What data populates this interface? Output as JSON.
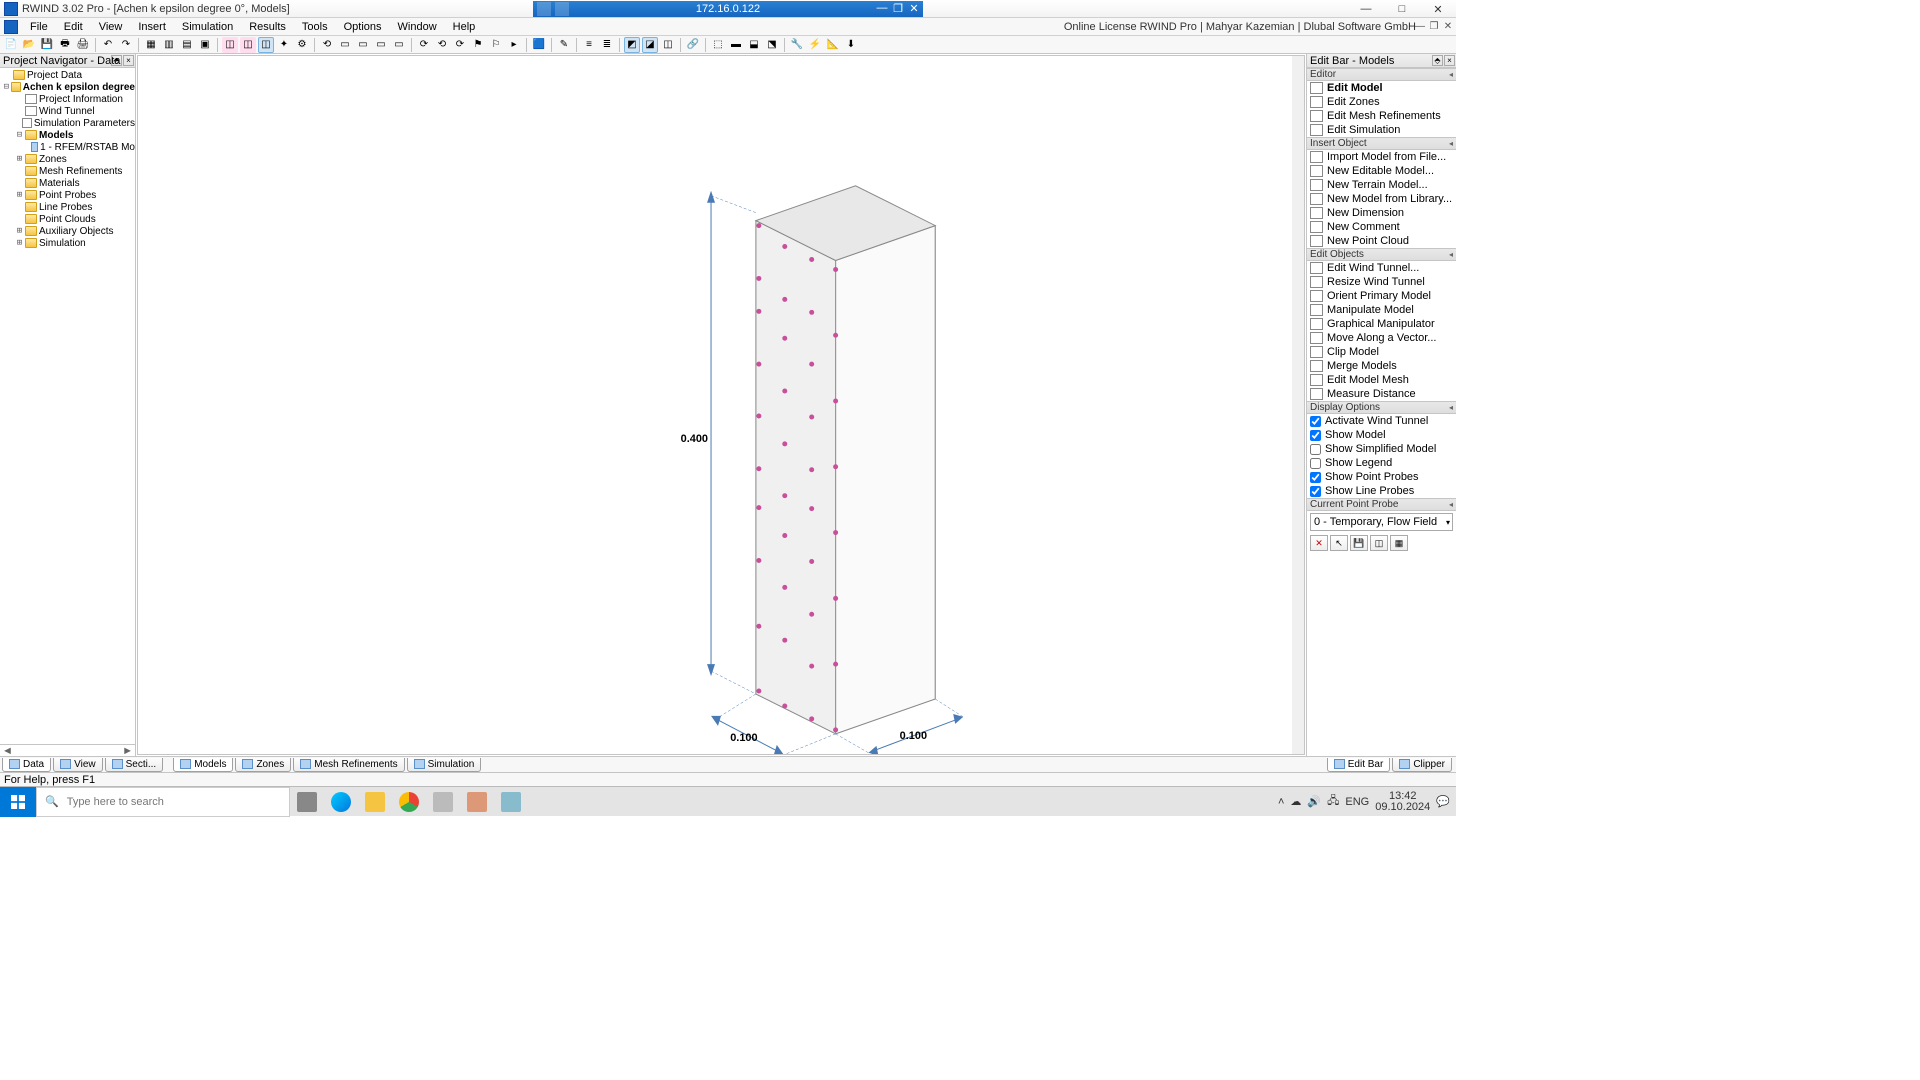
{
  "titlebar": {
    "title": "RWIND 3.02 Pro - [Achen  k epsilon degree 0°, Models]",
    "ip": "172.16.0.122"
  },
  "menubar": {
    "items": [
      "File",
      "Edit",
      "View",
      "Insert",
      "Simulation",
      "Results",
      "Tools",
      "Options",
      "Window",
      "Help"
    ],
    "license": "Online License RWIND Pro | Mahyar Kazemian | Dlubal Software GmbH"
  },
  "left": {
    "title": "Project Navigator - Data",
    "tree": [
      {
        "d": 0,
        "t": "",
        "i": "folder",
        "l": "Project Data",
        "b": false
      },
      {
        "d": 0,
        "t": "⊟",
        "i": "folder-open",
        "l": "Achen  k epsilon degree",
        "b": true
      },
      {
        "d": 1,
        "t": "",
        "i": "page",
        "l": "Project Information",
        "b": false
      },
      {
        "d": 1,
        "t": "",
        "i": "page",
        "l": "Wind Tunnel",
        "b": false
      },
      {
        "d": 1,
        "t": "",
        "i": "page",
        "l": "Simulation Parameters",
        "b": false
      },
      {
        "d": 1,
        "t": "⊟",
        "i": "folder-open",
        "l": "Models",
        "b": true
      },
      {
        "d": 2,
        "t": "",
        "i": "model",
        "l": "1 - RFEM/RSTAB Mo",
        "b": false
      },
      {
        "d": 1,
        "t": "⊞",
        "i": "folder",
        "l": "Zones",
        "b": false
      },
      {
        "d": 1,
        "t": "",
        "i": "folder",
        "l": "Mesh Refinements",
        "b": false
      },
      {
        "d": 1,
        "t": "",
        "i": "folder",
        "l": "Materials",
        "b": false
      },
      {
        "d": 1,
        "t": "⊞",
        "i": "folder",
        "l": "Point Probes",
        "b": false
      },
      {
        "d": 1,
        "t": "",
        "i": "folder",
        "l": "Line Probes",
        "b": false
      },
      {
        "d": 1,
        "t": "",
        "i": "folder",
        "l": "Point Clouds",
        "b": false
      },
      {
        "d": 1,
        "t": "⊞",
        "i": "folder",
        "l": "Auxiliary Objects",
        "b": false
      },
      {
        "d": 1,
        "t": "⊞",
        "i": "folder",
        "l": "Simulation",
        "b": false
      }
    ]
  },
  "viewport": {
    "dim_h": "0.400",
    "dim_w1": "0.100",
    "dim_w2": "0.100"
  },
  "right": {
    "title": "Edit Bar - Models",
    "sections": {
      "editor": {
        "hdr": "Editor",
        "items": [
          {
            "l": "Edit Model",
            "b": true
          },
          {
            "l": "Edit Zones",
            "b": false
          },
          {
            "l": "Edit Mesh Refinements",
            "b": false
          },
          {
            "l": "Edit Simulation",
            "b": false
          }
        ]
      },
      "insert": {
        "hdr": "Insert Object",
        "items": [
          {
            "l": "Import Model from File..."
          },
          {
            "l": "New Editable Model..."
          },
          {
            "l": "New Terrain Model..."
          },
          {
            "l": "New Model from Library..."
          },
          {
            "l": "New Dimension"
          },
          {
            "l": "New Comment"
          },
          {
            "l": "New Point Cloud"
          }
        ]
      },
      "editobj": {
        "hdr": "Edit Objects",
        "items": [
          {
            "l": "Edit Wind Tunnel..."
          },
          {
            "l": "Resize Wind Tunnel"
          },
          {
            "l": "Orient Primary Model"
          },
          {
            "l": "Manipulate Model"
          },
          {
            "l": "Graphical Manipulator"
          },
          {
            "l": "Move Along a Vector..."
          },
          {
            "l": "Clip Model"
          },
          {
            "l": "Merge Models"
          },
          {
            "l": "Edit Model Mesh"
          },
          {
            "l": "Measure Distance"
          }
        ]
      },
      "display": {
        "hdr": "Display Options",
        "items": [
          {
            "l": "Activate Wind Tunnel",
            "c": true
          },
          {
            "l": "Show Model",
            "c": true
          },
          {
            "l": "Show Simplified Model",
            "c": false
          },
          {
            "l": "Show Legend",
            "c": false
          },
          {
            "l": "Show Point Probes",
            "c": true
          },
          {
            "l": "Show Line Probes",
            "c": true
          }
        ]
      },
      "probe": {
        "hdr": "Current Point Probe",
        "sel": "0 - Temporary, Flow Field"
      }
    }
  },
  "bottom": {
    "left_tabs": [
      {
        "l": "Data"
      },
      {
        "l": "View"
      },
      {
        "l": "Secti..."
      }
    ],
    "mid_tabs": [
      {
        "l": "Models"
      },
      {
        "l": "Zones"
      },
      {
        "l": "Mesh Refinements"
      },
      {
        "l": "Simulation"
      }
    ],
    "right_tabs": [
      {
        "l": "Edit Bar"
      },
      {
        "l": "Clipper"
      }
    ]
  },
  "status": "For Help, press F1",
  "taskbar": {
    "search_placeholder": "Type here to search",
    "lang": "ENG",
    "time": "13:42",
    "date": "09.10.2024"
  }
}
